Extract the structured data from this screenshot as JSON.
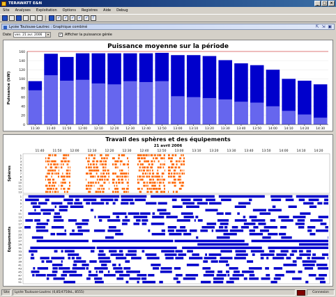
{
  "window": {
    "title": "TERAWATT E&N"
  },
  "menu": [
    "Site",
    "Analyses",
    "Exploitation",
    "Options",
    "Registres",
    "Aide",
    "Debug"
  ],
  "tab": {
    "label": "Lycée Toulouse-Lautrec : Graphique combiné"
  },
  "datebar": {
    "date_label": "Date",
    "date_value": "ven. 21 avr. 2006",
    "checkbox_label": "Afficher la puissance gérée"
  },
  "colors": {
    "dark": "#0000cc",
    "light": "#6666ee",
    "orange": "#ff6600",
    "reference": "#cc0000"
  },
  "chart_data": [
    {
      "type": "bar",
      "title": "Puissance moyenne sur la période",
      "ylabel": "Puissance (kW)",
      "ylim": [
        0,
        160
      ],
      "yticks": [
        0,
        20,
        40,
        60,
        80,
        100,
        120,
        140,
        160
      ],
      "categories": [
        "11:30",
        "11:40",
        "11:50",
        "12:00",
        "12:10",
        "12:20",
        "12:30",
        "12:40",
        "12:50",
        "13:00",
        "13:10",
        "13:20",
        "13:30",
        "13:40",
        "13:50",
        "14:00",
        "14:10",
        "14:20",
        "14:30"
      ],
      "stacked": true,
      "series": [
        {
          "values": [
            75,
            108,
            96,
            98,
            90,
            88,
            95,
            93,
            95,
            62,
            60,
            58,
            55,
            50,
            48,
            40,
            30,
            22,
            15
          ]
        },
        {
          "values": [
            95,
            155,
            148,
            156,
            156,
            156,
            156,
            156,
            157,
            152,
            152,
            150,
            141,
            134,
            130,
            120,
            100,
            96,
            88
          ]
        }
      ],
      "reference_line": 160,
      "x_range_label_ticks": true
    },
    {
      "type": "gantt",
      "title": "Travail des sphères et des équipements",
      "subtitle": "21 avril 2006",
      "time_ticks": [
        "11:40",
        "11:50",
        "12:00",
        "12:10",
        "12:20",
        "12:30",
        "12:40",
        "12:50",
        "13:00",
        "13:10",
        "13:20",
        "13:30",
        "13:40",
        "13:50",
        "14:00",
        "14:10",
        "14:20"
      ],
      "sections": [
        {
          "label": "Sphères",
          "rows": [
            "1",
            "2",
            "3",
            "4",
            "5",
            "6",
            "7",
            "8",
            "9",
            "10",
            "11",
            "12",
            "13"
          ]
        },
        {
          "label": "Equipements",
          "rows": [
            "1",
            "3",
            "5",
            "7",
            "9",
            "11",
            "13",
            "15",
            "17",
            "19",
            "21",
            "23",
            "25",
            "27",
            "29",
            "31",
            "33",
            "35",
            "37",
            "39",
            "41",
            "43",
            "45",
            "47",
            "49",
            "51"
          ]
        }
      ]
    }
  ],
  "statusbar": {
    "site_label": "Site",
    "site_value": "Lycée Toulouse-Lautrec (0,85/4750kL, 8555)",
    "connection": "Connexion"
  }
}
